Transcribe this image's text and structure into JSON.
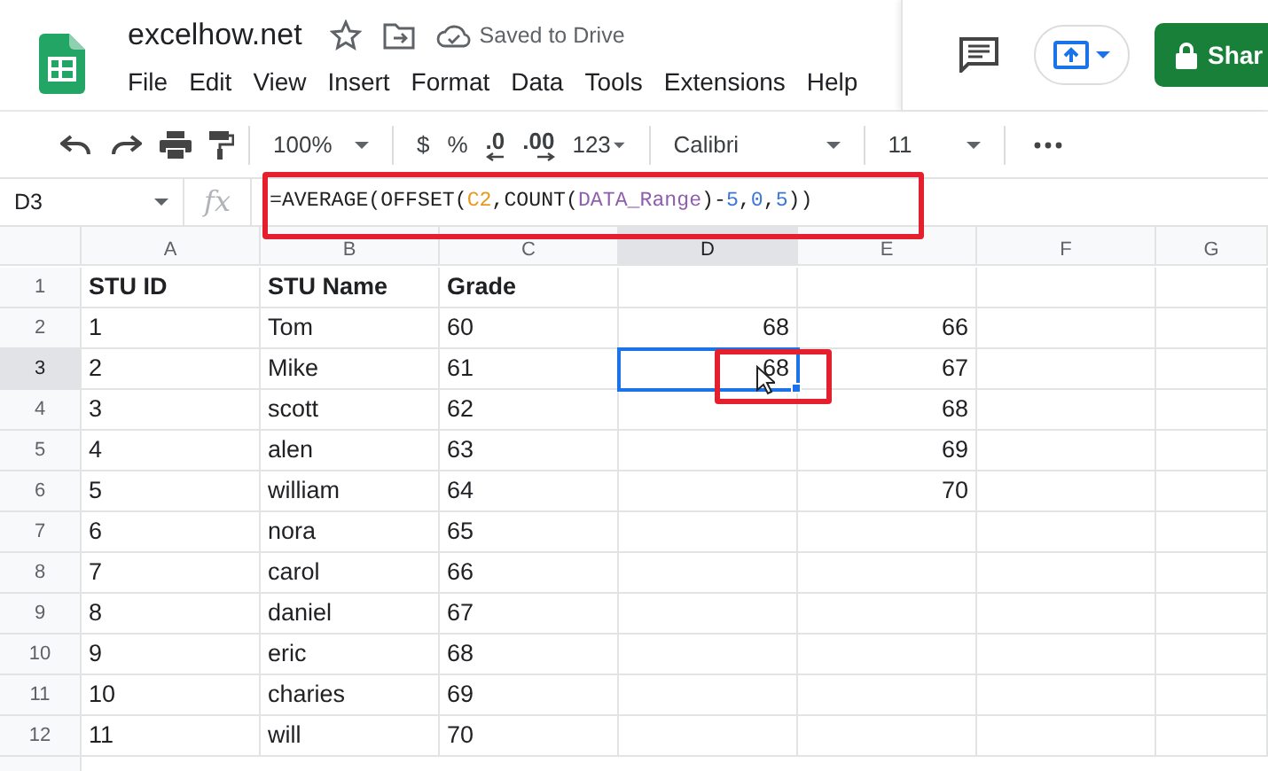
{
  "app": {
    "title": "excelhow.net",
    "save_status": "Saved to Drive",
    "share_label": "Shar"
  },
  "menu": [
    "File",
    "Edit",
    "View",
    "Insert",
    "Format",
    "Data",
    "Tools",
    "Extensions",
    "Help"
  ],
  "toolbar": {
    "zoom": "100%",
    "currency": "$",
    "percent": "%",
    "decrease_decimal": ".0",
    "increase_decimal": ".00",
    "number_format": "123",
    "font": "Calibri",
    "font_size": "11"
  },
  "formula_bar": {
    "name_box": "D3",
    "fx": "fx",
    "tokens": [
      {
        "text": "=AVERAGE(OFFSET(",
        "color": "#222222"
      },
      {
        "text": "C2",
        "color": "#e69a1c"
      },
      {
        "text": ",COUNT(",
        "color": "#222222"
      },
      {
        "text": "DATA_Range",
        "color": "#8e5fae"
      },
      {
        "text": ")-",
        "color": "#222222"
      },
      {
        "text": "5",
        "color": "#3d78d8"
      },
      {
        "text": ",",
        "color": "#222222"
      },
      {
        "text": "0",
        "color": "#3d78d8"
      },
      {
        "text": ",",
        "color": "#222222"
      },
      {
        "text": "5",
        "color": "#3d78d8"
      },
      {
        "text": "))",
        "color": "#222222"
      }
    ]
  },
  "columns": [
    {
      "label": "A",
      "selected": false
    },
    {
      "label": "B",
      "selected": false
    },
    {
      "label": "C",
      "selected": false
    },
    {
      "label": "D",
      "selected": true
    },
    {
      "label": "E",
      "selected": false
    },
    {
      "label": "F",
      "selected": false
    },
    {
      "label": "G",
      "selected": false
    }
  ],
  "rows": [
    {
      "number": "1",
      "selected": false,
      "bold": true,
      "cells": [
        "STU ID",
        "STU Name",
        "Grade"
      ]
    },
    {
      "number": "2",
      "selected": false,
      "bold": false,
      "cells": [
        "1",
        "Tom",
        "60",
        "68",
        "66"
      ]
    },
    {
      "number": "3",
      "selected": true,
      "bold": false,
      "cells": [
        "2",
        "Mike",
        "61",
        "68",
        "67"
      ]
    },
    {
      "number": "4",
      "selected": false,
      "bold": false,
      "cells": [
        "3",
        "scott",
        "62",
        null,
        "68"
      ]
    },
    {
      "number": "5",
      "selected": false,
      "bold": false,
      "cells": [
        "4",
        "alen",
        "63",
        null,
        "69"
      ]
    },
    {
      "number": "6",
      "selected": false,
      "bold": false,
      "cells": [
        "5",
        "william",
        "64",
        null,
        "70"
      ]
    },
    {
      "number": "7",
      "selected": false,
      "bold": false,
      "cells": [
        "6",
        "nora",
        "65"
      ]
    },
    {
      "number": "8",
      "selected": false,
      "bold": false,
      "cells": [
        "7",
        "carol",
        "66"
      ]
    },
    {
      "number": "9",
      "selected": false,
      "bold": false,
      "cells": [
        "8",
        "daniel",
        "67"
      ]
    },
    {
      "number": "10",
      "selected": false,
      "bold": false,
      "cells": [
        "9",
        "eric",
        "68"
      ]
    },
    {
      "number": "11",
      "selected": false,
      "bold": false,
      "cells": [
        "10",
        "charies",
        "69"
      ]
    },
    {
      "number": "12",
      "selected": false,
      "bold": false,
      "cells": [
        "11",
        "will",
        "70"
      ]
    }
  ]
}
